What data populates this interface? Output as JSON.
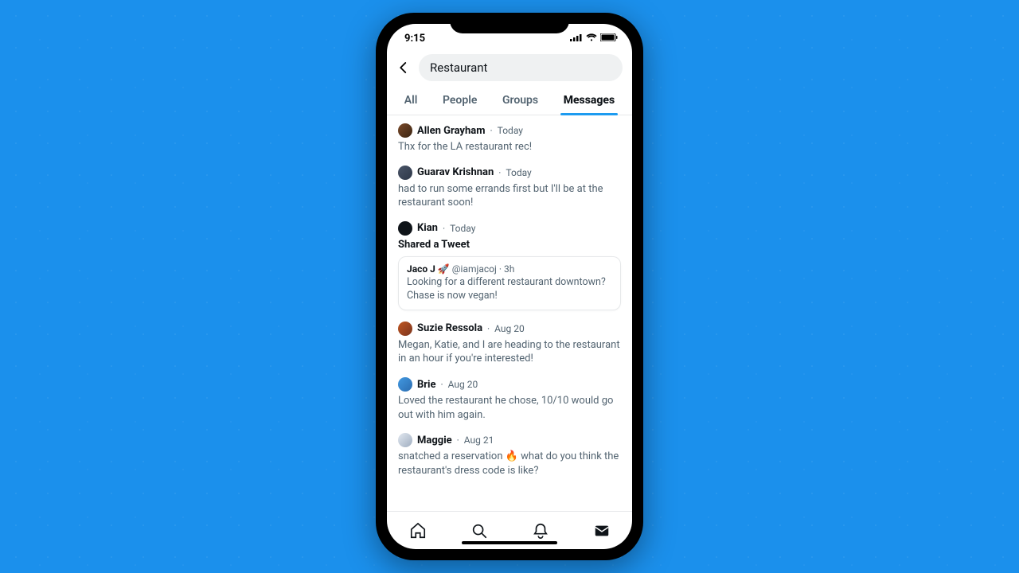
{
  "statusbar": {
    "time": "9:15"
  },
  "search": {
    "value": "Restaurant"
  },
  "tabs": {
    "items": [
      {
        "label": "All"
      },
      {
        "label": "People"
      },
      {
        "label": "Groups"
      },
      {
        "label": "Messages"
      }
    ],
    "active": 3
  },
  "results": [
    {
      "name": "Allen Grayham",
      "meta": "Today",
      "body": "Thx for the LA restaurant rec!",
      "avatar": "av1"
    },
    {
      "name": "Guarav Krishnan",
      "meta": "Today",
      "body": "had to run some errands first but I'll be at the restaurant soon!",
      "avatar": "av2"
    },
    {
      "name": "Kian",
      "meta": "Today",
      "body": "Shared a Tweet",
      "body_bold": true,
      "avatar": "av3",
      "tweet": {
        "name": "Jaco J 🚀",
        "handle": "@iamjacoj · 3h",
        "body": "Looking for a different restaurant downtown? Chase is now vegan!"
      }
    },
    {
      "name": "Suzie Ressola",
      "meta": "Aug 20",
      "body": "Megan, Katie, and I are heading to the restaurant in an hour if you're interested!",
      "avatar": "av4"
    },
    {
      "name": "Brie",
      "meta": "Aug 20",
      "body": "Loved the restaurant he chose, 10/10 would go out with him again.",
      "avatar": "av5"
    },
    {
      "name": "Maggie",
      "meta": "Aug 21",
      "body": "snatched a reservation 🔥 what do you think the restaurant's dress code is like?",
      "avatar": "av6"
    }
  ]
}
